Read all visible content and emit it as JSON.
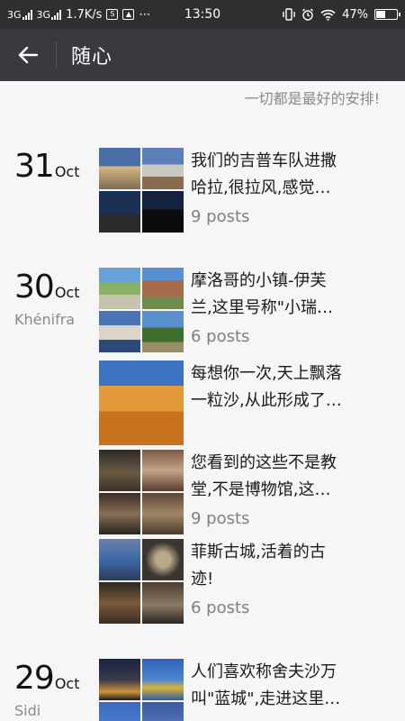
{
  "status_bar": {
    "network1": "3G",
    "network2": "3G",
    "speed": "1.7K/s",
    "time": "13:50",
    "battery": "47%",
    "battery_level": 0.47
  },
  "header": {
    "title": "随心"
  },
  "signature": "一切都是最好的安排!",
  "groups": [
    {
      "day": "31",
      "month": "Oct",
      "location": "",
      "entries": [
        {
          "text_line1": "我们的吉普车队进撒",
          "text_line2": "哈拉,很拉风,感觉…",
          "count": "9 posts"
        }
      ]
    },
    {
      "day": "30",
      "month": "Oct",
      "location": "Khénifra",
      "entries": [
        {
          "text_line1": "摩洛哥的小镇-伊芙",
          "text_line2": "兰,这里号称\"小瑞…",
          "count": "6 posts"
        },
        {
          "text_line1": "每想你一次,天上飘落",
          "text_line2": "一粒沙,从此形成了…",
          "count": ""
        },
        {
          "text_line1": "您看到的这些不是教",
          "text_line2": "堂,不是博物馆,这…",
          "count": "9 posts"
        },
        {
          "text_line1": "菲斯古城,活着的古",
          "text_line2": "迹!",
          "count": "6 posts"
        }
      ]
    },
    {
      "day": "29",
      "month": "Oct",
      "location": "Sidi",
      "entries": [
        {
          "text_line1": "人们喜欢称舍夫沙万",
          "text_line2": "叫\"蓝城\",走进这里…",
          "count": ""
        }
      ]
    }
  ]
}
